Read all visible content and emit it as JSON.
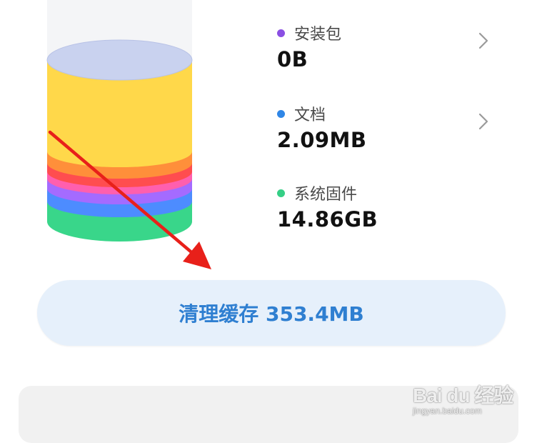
{
  "storage_items": [
    {
      "label": "安装包",
      "value": "0B",
      "dot_color": "#8a4fe3",
      "has_chevron": true
    },
    {
      "label": "文档",
      "value": "2.09MB",
      "dot_color": "#2f86e6",
      "has_chevron": true
    },
    {
      "label": "系统固件",
      "value": "14.86GB",
      "dot_color": "#35cf86",
      "has_chevron": false
    }
  ],
  "clean_button": {
    "label": "清理缓存 353.4MB"
  },
  "cylinder_colors": {
    "top": "#c9d2ef",
    "yellow": "#ffd84a",
    "orange": "#ff8f3a",
    "red": "#ff4d4f",
    "pink": "#ff5fae",
    "purple": "#a46bff",
    "blue": "#4d8cff",
    "green": "#39d68a",
    "empty": "#f4f5f7"
  },
  "annotation": {
    "arrow_color": "#e8201a"
  },
  "watermark": {
    "brand": "Bai du 经验",
    "sub": "jingyan.baidu.com"
  }
}
